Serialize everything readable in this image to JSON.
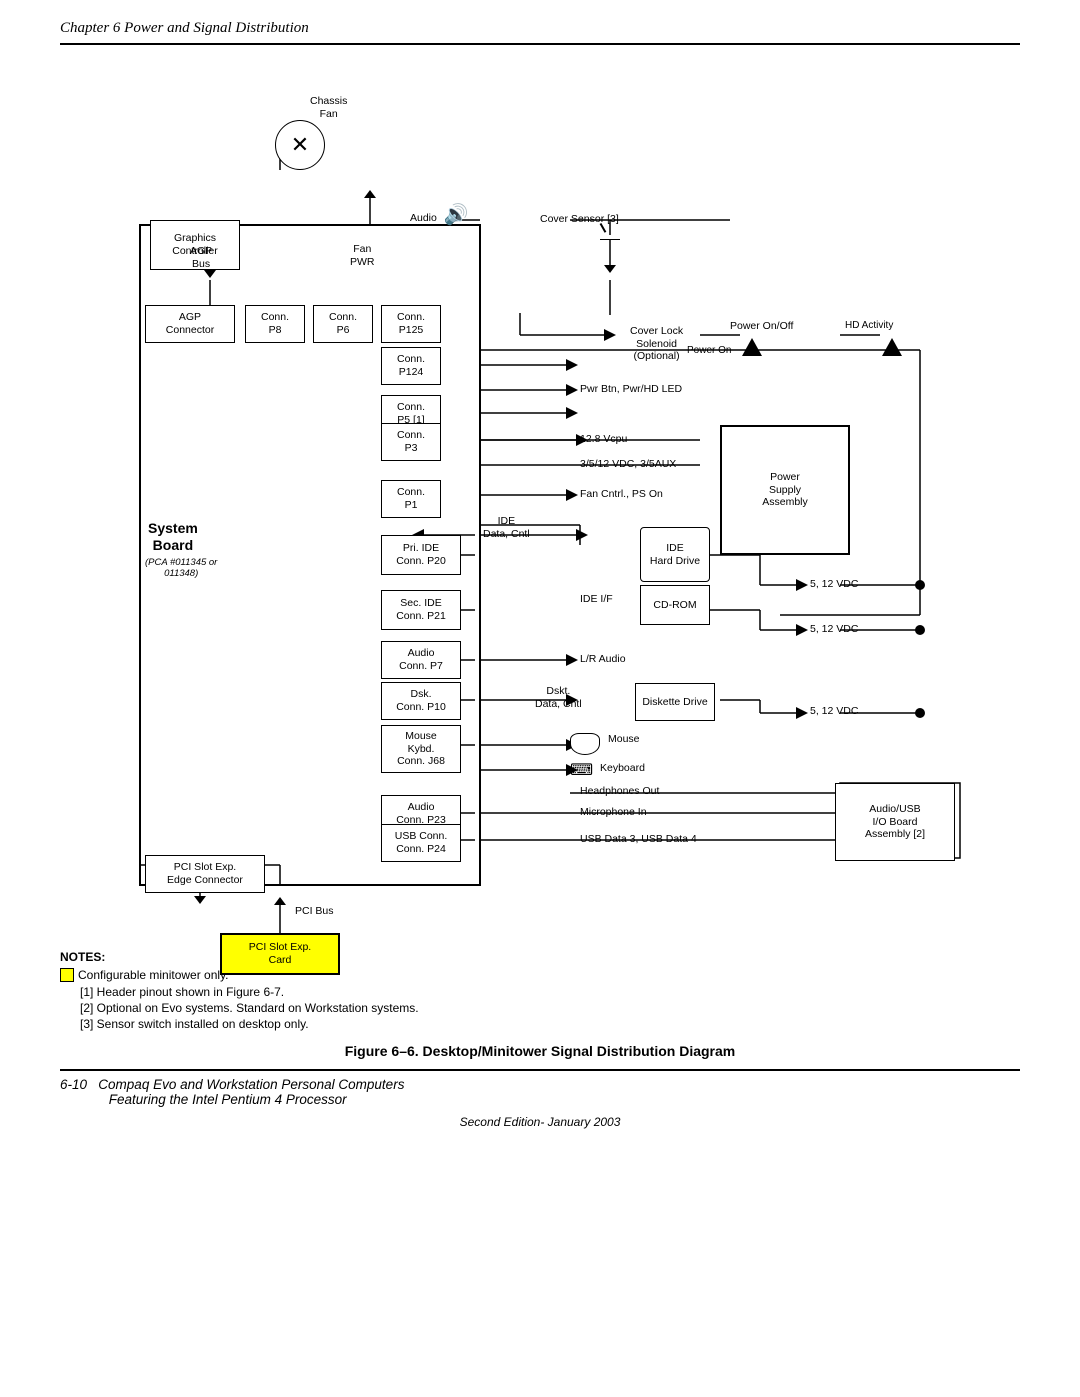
{
  "header": {
    "chapter_title": "Chapter 6  Power and Signal Distribution"
  },
  "diagram": {
    "title": "Figure 6–6.  Desktop/Minitower Signal Distribution Diagram",
    "components": {
      "chassis_fan_label": "Chassis\nFan",
      "graphics_controller": "Graphics\nController",
      "audio_label": "Audio",
      "cover_sensor": "Cover Sensor [3]",
      "agp_bus": "AGP\nBus",
      "fan_pwr": "Fan\nPWR",
      "agp_connector": "AGP\nConnector",
      "conn_p8": "Conn.\nP8",
      "conn_p6": "Conn.\nP6",
      "conn_p125": "Conn.\nP125",
      "cover_lock": "Cover Lock\nSolenoid\n(Optional)",
      "power_on_off": "Power On/Off",
      "power_on": "Power On",
      "hd_activity": "HD Activity",
      "conn_p124": "Conn.\nP124",
      "pwr_btn": "Pwr Btn, Pwr/HD LED",
      "conn_p5": "Conn.\nP5 [1]",
      "conn_p3": "Conn.\nP3",
      "vcpu": "12.8 Vcpu",
      "vdc_3_5_12": "3/5/12 VDC, 3/5AUX",
      "conn_p1": "Conn.\nP1",
      "fan_cntrl": "Fan Cntrl., PS On",
      "power_supply": "Power\nSupply\nAssembly",
      "ide_data": "IDE\nData, Cntl",
      "pri_ide": "Pri. IDE\nConn. P20",
      "ide_hard_drive": "IDE\nHard Drive",
      "vdc_5_12_1": "5, 12 VDC",
      "sec_ide": "Sec. IDE\nConn. P21",
      "ide_if": "IDE I/F",
      "cd_rom": "CD-ROM",
      "vdc_5_12_2": "5, 12 VDC",
      "audio_conn_p7": "Audio\nConn. P7",
      "lr_audio": "L/R Audio",
      "dsk_conn_p10": "Dsk.\nConn. P10",
      "dskt_data": "Dskt.\nData, Cntl",
      "diskette_drive": "Diskette Drive",
      "vdc_5_12_3": "5, 12 VDC",
      "mouse_kybd": "Mouse\nKybd.\nConn. J68",
      "mouse_label": "Mouse",
      "keyboard_label": "Keyboard",
      "headphones_out": "Headphones Out",
      "audio_conn_p23": "Audio\nConn. P23",
      "microphone_in": "Microphone In",
      "usb_conn_p24": "USB Conn.\nConn. P24",
      "usb_data": "USB Data 3, USB Data 4",
      "audio_usb": "Audio/USB\nI/O Board\nAssembly [2]",
      "pci_slot_exp": "PCI Slot Exp.\nEdge Connector",
      "pci_bus_label": "PCI Bus",
      "pci_card": "PCI Slot Exp.\nCard",
      "system_board": "System\nBoard",
      "system_board_sub": "(PCA #011345 or\n011348)"
    }
  },
  "notes": {
    "title": "NOTES:",
    "items": [
      "Configurable minitower only.",
      "[1]  Header pinout shown in Figure 6-7.",
      "[2]  Optional on Evo systems. Standard on Workstation systems.",
      "[3]  Sensor switch installed on desktop only."
    ]
  },
  "footer": {
    "page_num": "6-10",
    "book_title": "Compaq Evo and Workstation Personal Computers",
    "book_subtitle": "Featuring the Intel Pentium 4 Processor",
    "edition": "Second Edition- January 2003"
  }
}
